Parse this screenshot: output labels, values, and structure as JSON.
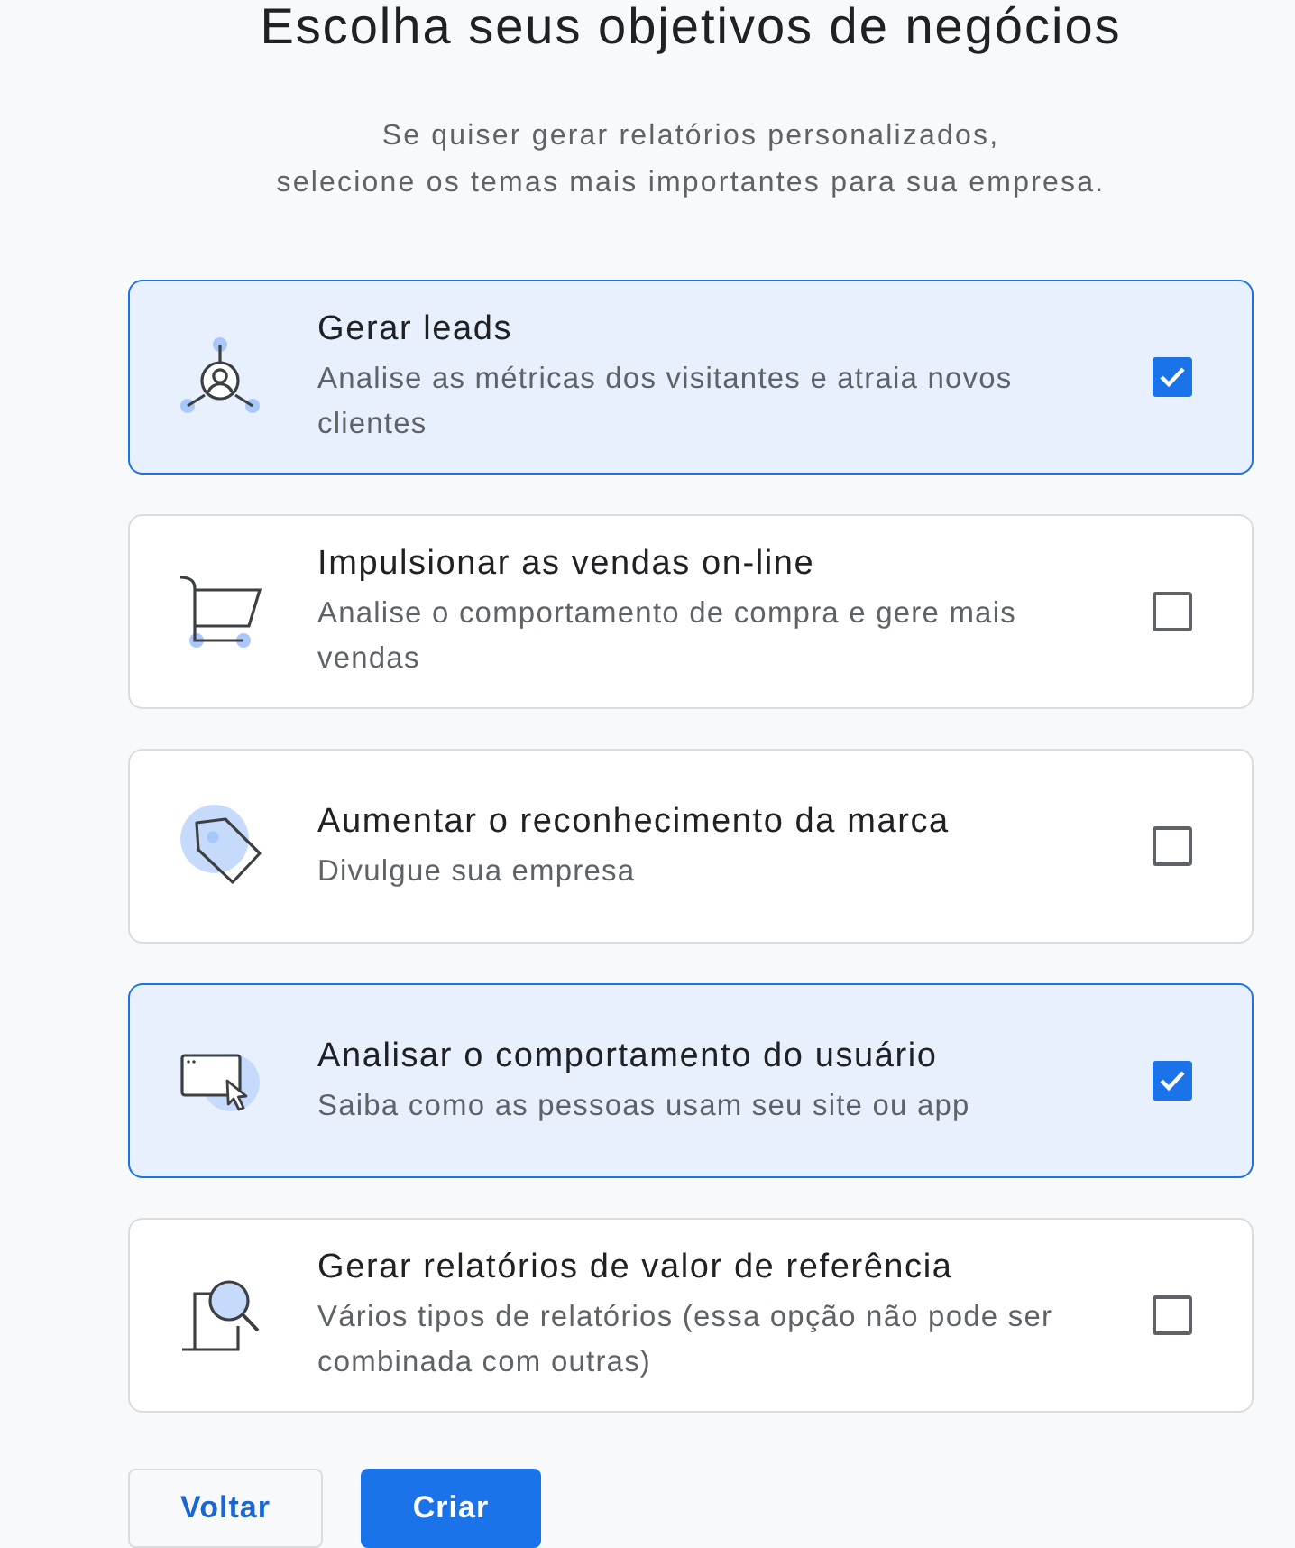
{
  "title": "Escolha seus objetivos de negócios",
  "subtitle": [
    "Se quiser gerar relatórios personalizados,",
    "selecione os temas mais importantes para sua empresa."
  ],
  "objectives": [
    {
      "kind": "leads",
      "title": "Gerar leads",
      "description": "Analise as métricas dos visitantes e atraia novos clientes",
      "checked": true
    },
    {
      "kind": "sales",
      "title": "Impulsionar as vendas on-line",
      "description": "Analise o comportamento de compra e gere mais vendas",
      "checked": false
    },
    {
      "kind": "brand",
      "title": "Aumentar o reconhecimento da marca",
      "description": "Divulgue sua empresa",
      "checked": false
    },
    {
      "kind": "behavior",
      "title": "Analisar o comportamento do usuário",
      "description": "Saiba como as pessoas usam seu site ou app",
      "checked": true
    },
    {
      "kind": "benchmark",
      "title": "Gerar relatórios de valor de referência",
      "description": "Vários tipos de relatórios (essa opção não pode ser combinada com outras)",
      "checked": false
    }
  ],
  "buttons": [
    {
      "kind": "secondary",
      "label": "Voltar"
    },
    {
      "kind": "primary",
      "label": "Criar"
    }
  ]
}
